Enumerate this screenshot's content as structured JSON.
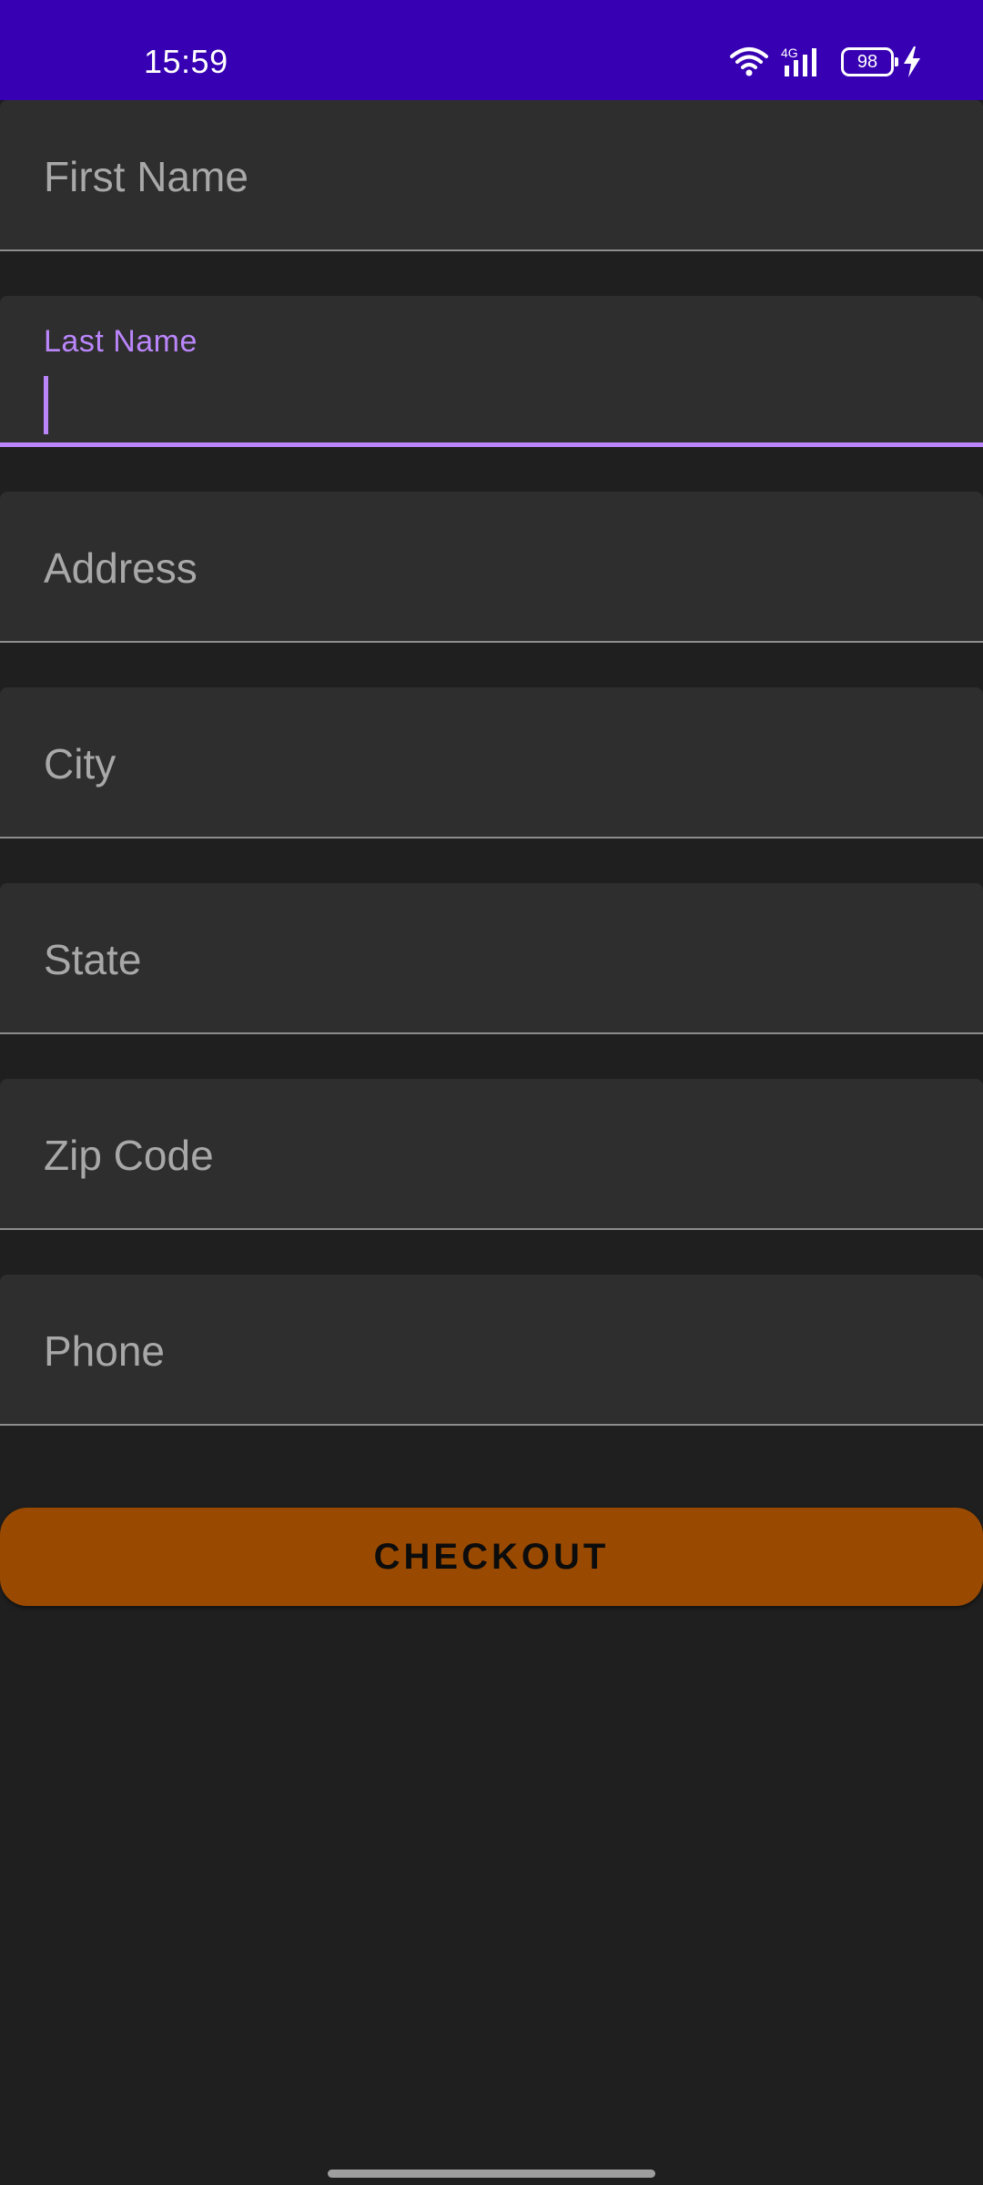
{
  "status_bar": {
    "time": "15:59",
    "network": "4G",
    "battery": "98",
    "bg_color": "#3700b3",
    "icons": [
      "wifi-icon",
      "signal-icon",
      "battery-icon",
      "charging-icon"
    ]
  },
  "form": {
    "fields": [
      {
        "placeholder": "First Name",
        "value": ""
      },
      {
        "label": "Last Name",
        "value": "",
        "focused": true
      },
      {
        "placeholder": "Address",
        "value": ""
      },
      {
        "placeholder": "City",
        "value": ""
      },
      {
        "placeholder": "State",
        "value": ""
      },
      {
        "placeholder": "Zip Code",
        "value": ""
      },
      {
        "placeholder": "Phone",
        "value": ""
      }
    ]
  },
  "checkout": {
    "label": "CHECKOUT",
    "color": "#994a00"
  },
  "colors": {
    "background": "#1f1f1f",
    "field_bg": "#2e2e2e",
    "accent": "#bb86fc"
  }
}
